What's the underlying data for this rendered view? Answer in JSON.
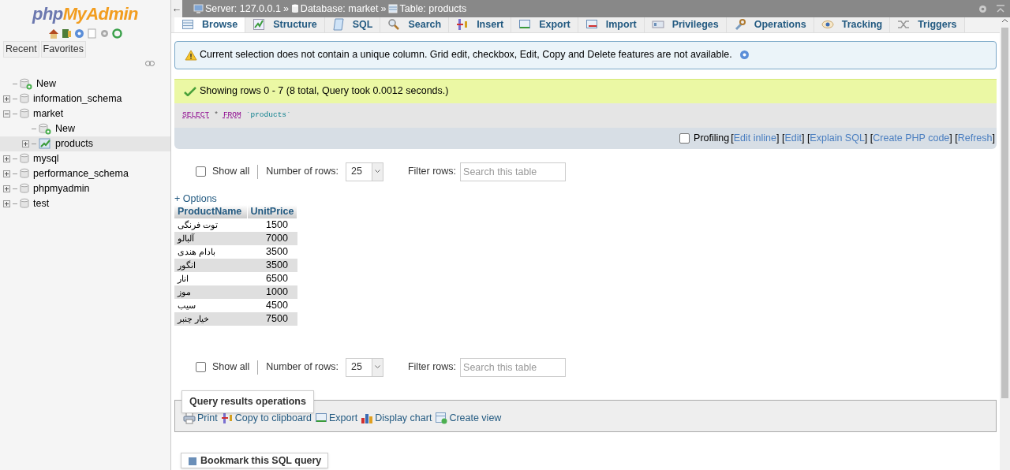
{
  "sidebar": {
    "logo": {
      "part1": "php",
      "part2": "MyAdmin"
    },
    "tabs": [
      "Recent",
      "Favorites"
    ],
    "tree": [
      {
        "label": "New",
        "kind": "new",
        "selected": false
      },
      {
        "label": "information_schema",
        "kind": "db",
        "expanded": false,
        "selected": false
      },
      {
        "label": "market",
        "kind": "db",
        "expanded": true,
        "selected": false,
        "children": [
          {
            "label": "New",
            "kind": "new",
            "selected": false
          },
          {
            "label": "products",
            "kind": "table",
            "expanded": false,
            "selected": true
          }
        ]
      },
      {
        "label": "mysql",
        "kind": "db",
        "expanded": false,
        "selected": false
      },
      {
        "label": "performance_schema",
        "kind": "db",
        "expanded": false,
        "selected": false
      },
      {
        "label": "phpmyadmin",
        "kind": "db",
        "expanded": false,
        "selected": false
      },
      {
        "label": "test",
        "kind": "db",
        "expanded": false,
        "selected": false
      }
    ]
  },
  "breadcrumb": [
    {
      "label": "Server: 127.0.0.1",
      "kind": "server"
    },
    {
      "label": "»",
      "kind": "sep"
    },
    {
      "label": "Database: market",
      "kind": "db"
    },
    {
      "label": "»",
      "kind": "sep"
    },
    {
      "label": "Table: products",
      "kind": "table"
    }
  ],
  "back_arrow": "←",
  "tabs": [
    {
      "label": "Browse",
      "kind": "browse",
      "selected": true
    },
    {
      "label": "Structure",
      "kind": "structure",
      "selected": false
    },
    {
      "label": "SQL",
      "kind": "sql",
      "selected": false
    },
    {
      "label": "Search",
      "kind": "search",
      "selected": false
    },
    {
      "label": "Insert",
      "kind": "insert",
      "selected": false
    },
    {
      "label": "Export",
      "kind": "export",
      "selected": false
    },
    {
      "label": "Import",
      "kind": "import",
      "selected": false
    },
    {
      "label": "Privileges",
      "kind": "privileges",
      "selected": false
    },
    {
      "label": "Operations",
      "kind": "operations",
      "selected": false
    },
    {
      "label": "Tracking",
      "kind": "tracking",
      "selected": false
    },
    {
      "label": "Triggers",
      "kind": "triggers",
      "selected": false
    }
  ],
  "warning": "Current selection does not contain a unique column. Grid edit, checkbox, Edit, Copy and Delete features are not available.",
  "success": "Showing rows 0 - 7 (8 total, Query took 0.0012 seconds.)",
  "sql_query": [
    {
      "text": "SELECT",
      "kind": "keyword"
    },
    {
      "text": "*",
      "kind": "op"
    },
    {
      "text": "FROM",
      "kind": "keyword"
    },
    {
      "text": "`products`",
      "kind": "name"
    }
  ],
  "profiling": {
    "checked": false,
    "label": "Profiling",
    "parts": [
      {
        "text": "[",
        "kind": "text"
      },
      {
        "text": "Edit inline",
        "kind": "link"
      },
      {
        "text": "] [",
        "kind": "text"
      },
      {
        "text": "Edit",
        "kind": "link"
      },
      {
        "text": "] [",
        "kind": "text"
      },
      {
        "text": "Explain SQL",
        "kind": "link"
      },
      {
        "text": "] [",
        "kind": "text"
      },
      {
        "text": "Create PHP code",
        "kind": "link"
      },
      {
        "text": "] [",
        "kind": "text"
      },
      {
        "text": "Refresh",
        "kind": "link"
      },
      {
        "text": "]",
        "kind": "text"
      }
    ]
  },
  "navigation": [
    {
      "show_all": {
        "checked": false,
        "label": "Show all"
      },
      "rows_label": "Number of rows:",
      "rows_value": "25",
      "filter_label": "Filter rows:",
      "placeholder": "Search this table"
    },
    {
      "show_all": {
        "checked": false,
        "label": "Show all"
      },
      "rows_label": "Number of rows:",
      "rows_value": "25",
      "filter_label": "Filter rows:",
      "placeholder": "Search this table"
    }
  ],
  "options_link": "+ Options",
  "table": {
    "columns": [
      "ProductName",
      "UnitPrice"
    ],
    "rows": [
      [
        "توت فرنگی",
        "1500"
      ],
      [
        "آلبالو",
        "7000"
      ],
      [
        "بادام هندی",
        "3500"
      ],
      [
        "انگور",
        "3500"
      ],
      [
        "انار",
        "6500"
      ],
      [
        "موز",
        "1000"
      ],
      [
        "سیب",
        "4500"
      ],
      [
        "خیار چنبر",
        "7500"
      ]
    ]
  },
  "operations": {
    "title": "Query results operations",
    "items": [
      {
        "label": "Print",
        "kind": "print"
      },
      {
        "label": "Copy to clipboard",
        "kind": "copy"
      },
      {
        "label": "Export",
        "kind": "export"
      },
      {
        "label": "Display chart",
        "kind": "chart"
      },
      {
        "label": "Create view",
        "kind": "view"
      }
    ]
  },
  "bookmark": {
    "title": "Bookmark this SQL query"
  }
}
